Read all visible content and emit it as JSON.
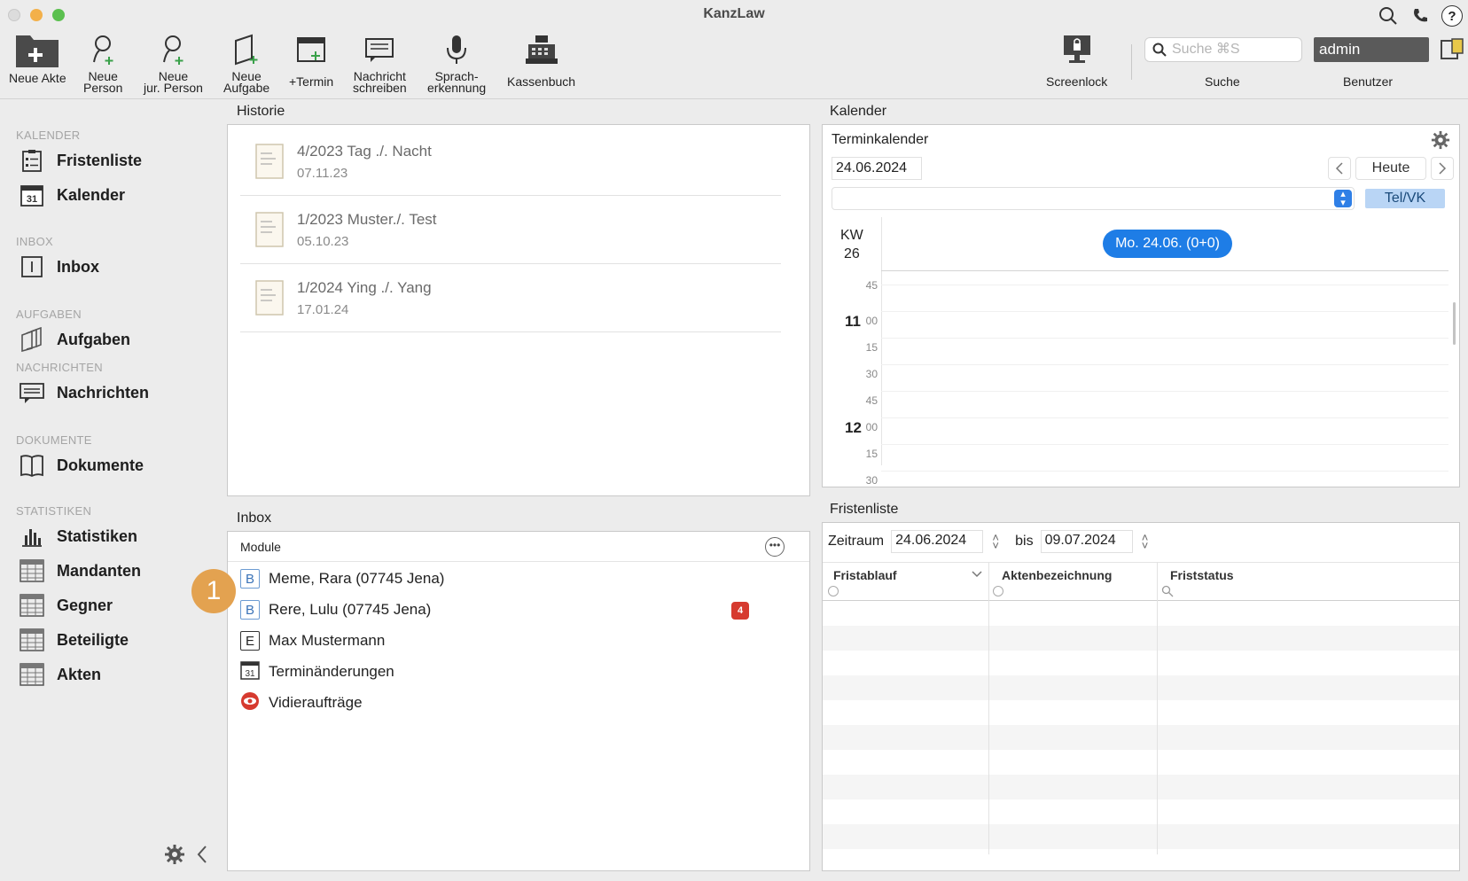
{
  "window": {
    "title": "KanzLaw"
  },
  "toolbar": {
    "neue_akte": "Neue Akte",
    "neue_person": [
      "Neue",
      "Person"
    ],
    "neue_jur_person": [
      "Neue",
      "jur. Person"
    ],
    "neue_aufgabe": [
      "Neue",
      "Aufgabe"
    ],
    "termin": "+Termin",
    "nachricht": [
      "Nachricht",
      "schreiben"
    ],
    "sprach": [
      "Sprach-",
      "erkennung"
    ],
    "kassenbuch": "Kassenbuch",
    "screenlock": "Screenlock",
    "search_placeholder": "Suche ⌘S",
    "search_label": "Suche",
    "user_value": "admin",
    "user_label": "Benutzer"
  },
  "sidebar": {
    "sections": {
      "kalender": "KALENDER",
      "inbox": "INBOX",
      "aufgaben": "AUFGABEN",
      "nachrichten": "NACHRICHTEN",
      "dokumente": "DOKUMENTE",
      "statistiken": "STATISTIKEN"
    },
    "items": {
      "fristenliste": "Fristenliste",
      "kalender": "Kalender",
      "kalender_icon_num": "31",
      "inbox": "Inbox",
      "aufgaben": "Aufgaben",
      "nachrichten": "Nachrichten",
      "dokumente": "Dokumente",
      "statistiken": "Statistiken",
      "mandanten": "Mandanten",
      "gegner": "Gegner",
      "beteiligte": "Beteiligte",
      "akten": "Akten"
    }
  },
  "historie": {
    "title": "Historie",
    "rows": [
      {
        "title": "4/2023 Tag ./. Nacht",
        "date": "07.11.23"
      },
      {
        "title": "1/2023 Muster./. Test",
        "date": "05.10.23"
      },
      {
        "title": "1/2024 Ying ./. Yang",
        "date": "17.01.24"
      }
    ]
  },
  "kalender": {
    "title": "Kalender",
    "subtitle": "Terminkalender",
    "date": "24.06.2024",
    "today_btn": "Heute",
    "tel_btn": "Tel/VK",
    "kw_label": "KW",
    "kw_num": "26",
    "day_pill": "Mo. 24.06. (0+0)",
    "times": {
      "t1": "45",
      "h11": "11",
      "t2": "00",
      "t3": "15",
      "t4": "30",
      "t5": "45",
      "h12": "12",
      "t6": "00",
      "t7": "15",
      "t8": "30"
    }
  },
  "inbox": {
    "title": "Inbox",
    "module_label": "Module",
    "rows": [
      {
        "icon": "B",
        "label": "Meme, Rara (07745 Jena)"
      },
      {
        "icon": "B",
        "label": "Rere, Lulu (07745 Jena)",
        "badge": "4"
      },
      {
        "icon": "E",
        "label": "Max Mustermann"
      },
      {
        "icon": "31",
        "label": "Terminänderungen"
      },
      {
        "icon": "eye-icon",
        "label": "Vidieraufträge"
      }
    ],
    "callout": "1"
  },
  "fristenliste": {
    "title": "Fristenliste",
    "zeitraum_label": "Zeitraum",
    "from": "24.06.2024",
    "bis_label": "bis",
    "to": "09.07.2024",
    "columns": [
      "Fristablauf",
      "Aktenbezeichnung",
      "Friststatus"
    ]
  },
  "colors": {
    "accent": "#1e7de6",
    "badge": "#d63a2f",
    "callout": "#e3a250"
  }
}
